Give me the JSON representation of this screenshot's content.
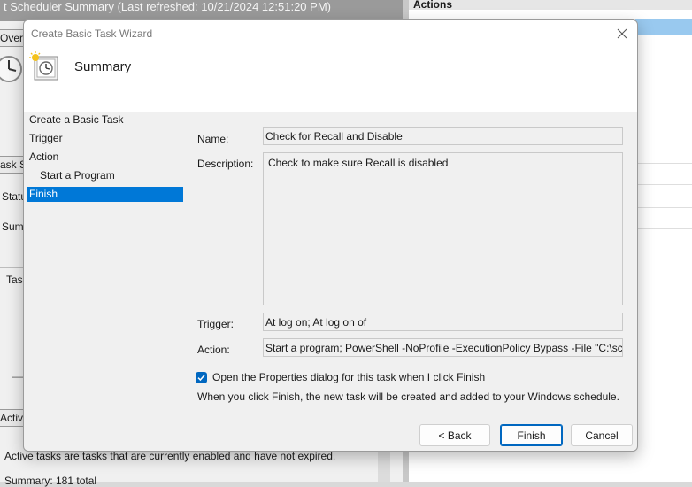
{
  "background": {
    "title": "t Scheduler Summary (Last refreshed: 10/21/2024 12:51:20 PM)",
    "actions_heading": "Actions",
    "tab_overview": "Overvi",
    "tab_task_status": "ask S",
    "label_status": "Statu",
    "label_summary": "Sum",
    "label_tasks": "Task",
    "tab_active": "Active",
    "active_description": "Active tasks are tasks that are currently enabled and have not expired.",
    "summary_total": "Summary: 181 total",
    "minus_glyph": "—"
  },
  "dialog": {
    "title": "Create Basic Task Wizard",
    "close_glyph": "✕",
    "header_title": "Summary",
    "nav": [
      {
        "label": "Create a Basic Task",
        "selected": false
      },
      {
        "label": "Trigger",
        "selected": false
      },
      {
        "label": "Action",
        "selected": false
      },
      {
        "label": "Start a Program",
        "selected": false
      },
      {
        "label": "Finish",
        "selected": true
      }
    ],
    "fields": {
      "name_label": "Name:",
      "name_value": "Check for Recall and Disable",
      "description_label": "Description:",
      "description_value": "Check to make sure Recall is disabled",
      "trigger_label": "Trigger:",
      "trigger_value": "At log on; At log on of",
      "action_label": "Action:",
      "action_value": "Start a program; PowerShell -NoProfile -ExecutionPolicy Bypass -File \"C:\\scrip"
    },
    "open_properties": {
      "label": "Open the Properties dialog for this task when I click Finish",
      "checked": true
    },
    "info_text": "When you click Finish, the new task will be created and added to your Windows schedule.",
    "buttons": {
      "back": "< Back",
      "finish": "Finish",
      "cancel": "Cancel"
    }
  },
  "colors": {
    "accent": "#0078d7",
    "checkbox": "#0067c0",
    "selection_bg": "#99c9ef"
  }
}
